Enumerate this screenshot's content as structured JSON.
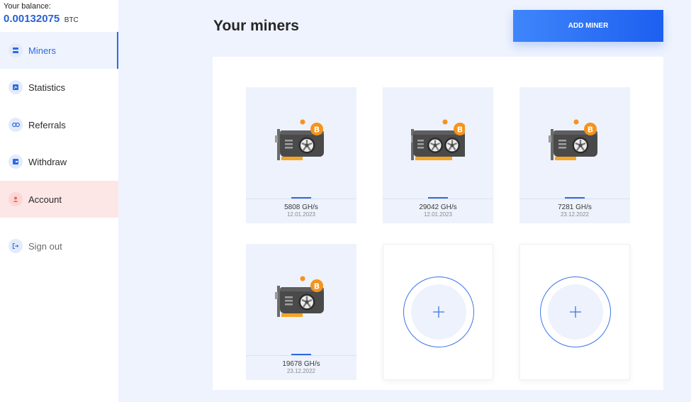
{
  "balance": {
    "label": "Your balance:",
    "value": "0.00132075",
    "unit": "BTC"
  },
  "nav": {
    "miners": "Miners",
    "statistics": "Statistics",
    "referrals": "Referrals",
    "withdraw": "Withdraw",
    "account": "Account",
    "signout": "Sign out"
  },
  "header": {
    "title": "Your miners",
    "add_button": "ADD MINER"
  },
  "miners": [
    {
      "rate": "5808 GH/s",
      "date": "12.01.2023",
      "fans": 1
    },
    {
      "rate": "29042 GH/s",
      "date": "12.01.2023",
      "fans": 2
    },
    {
      "rate": "7281 GH/s",
      "date": "23.12.2022",
      "fans": 1
    },
    {
      "rate": "19678 GH/s",
      "date": "23.12.2022",
      "fans": 1
    }
  ],
  "icons": {
    "gpu": "gpu-card-icon",
    "bitcoin": "bitcoin-coin-icon",
    "plus": "plus-icon"
  },
  "colors": {
    "accent": "#2f6ae0",
    "bitcoin": "#f7931a",
    "account_bg": "#fde6e6"
  }
}
